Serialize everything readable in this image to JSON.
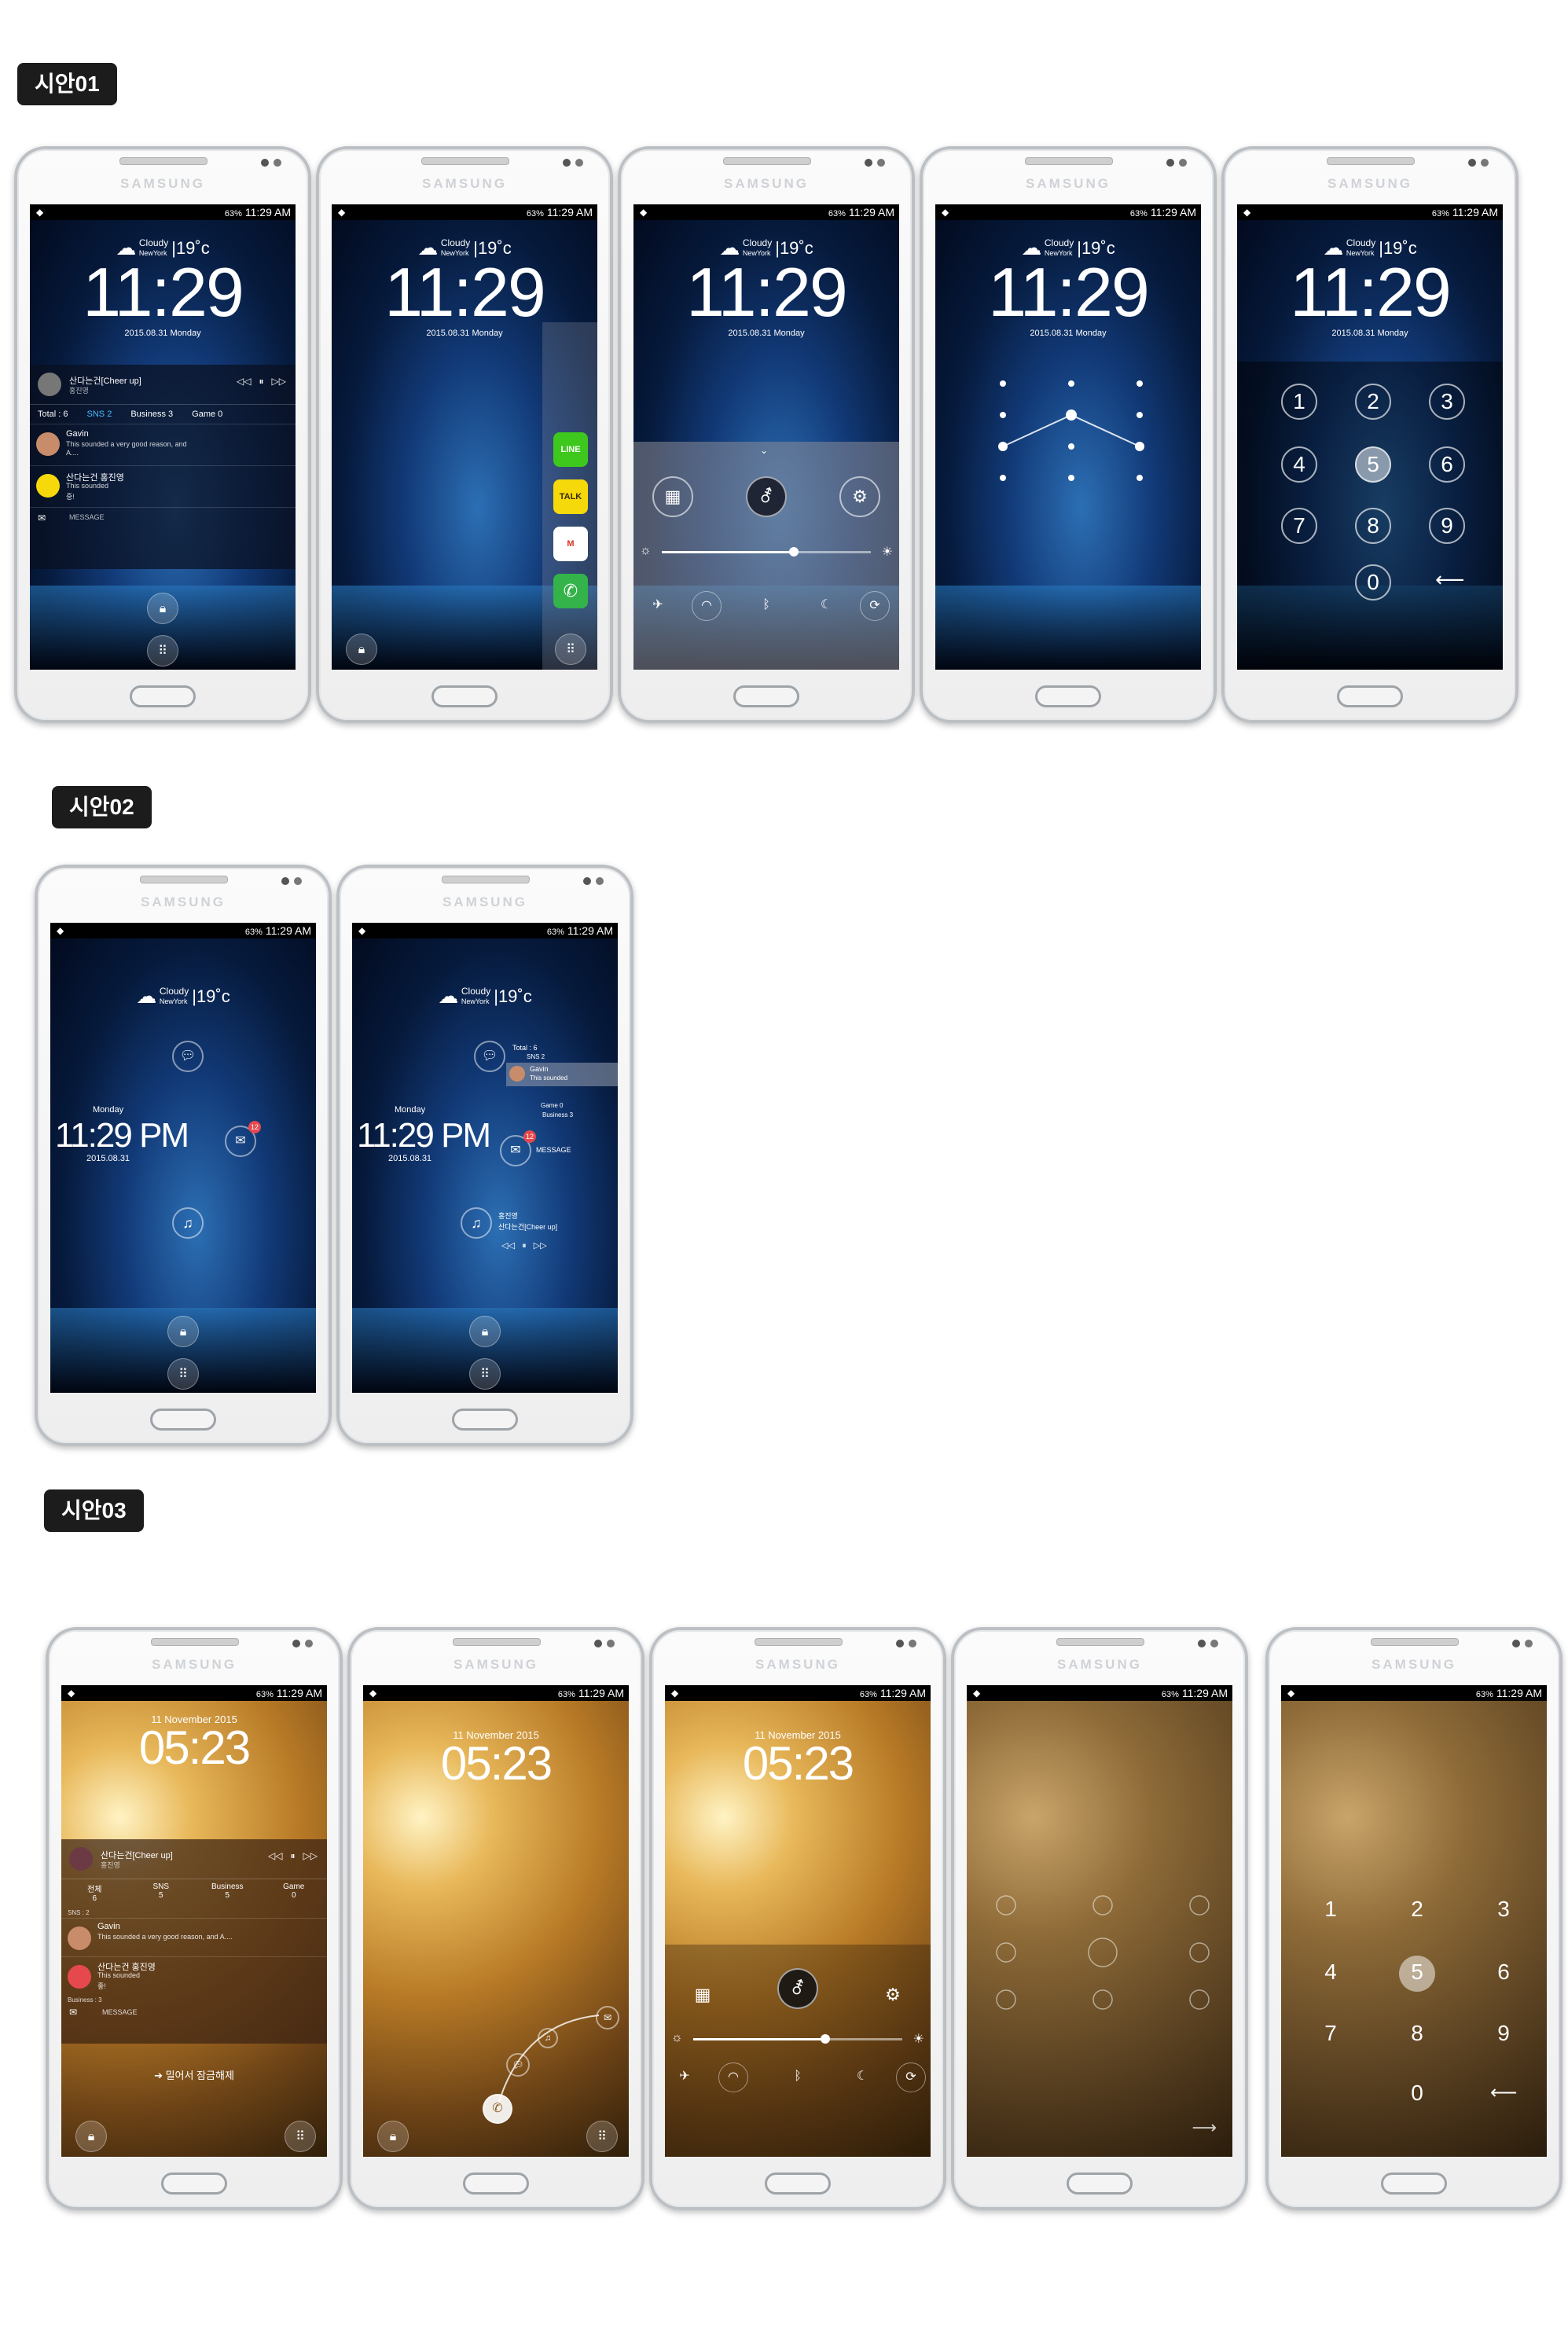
{
  "sections": {
    "s1": "시안01",
    "s2": "시안02",
    "s3": "시안03"
  },
  "device": {
    "brand": "SAMSUNG"
  },
  "status": {
    "battery": "63%",
    "time": "11:29 AM"
  },
  "night": {
    "weather": {
      "cond": "Cloudy",
      "city": "NewYork",
      "temp": "|19˚c"
    },
    "clock": "11:29",
    "date": "2015.08.31 Monday",
    "music": {
      "title": "산다는건[Cheer up]",
      "artist": "홍진영"
    },
    "tabs": {
      "total": "Total : 6",
      "sns": "SNS 2",
      "business": "Business 3",
      "game": "Game 0"
    },
    "notif1": {
      "name": "Gavin",
      "text": "This sounded a very good reason, and A...."
    },
    "notif2": {
      "name": "산다는건 홍진영",
      "text": "This sounded",
      "sub": "중!"
    },
    "message": "MESSAGE",
    "apps": {
      "line": "LINE",
      "talk": "TALK",
      "mail": "M",
      "phone": "✆"
    },
    "keypad": [
      "1",
      "2",
      "3",
      "4",
      "5",
      "6",
      "7",
      "8",
      "9",
      "0"
    ]
  },
  "v2": {
    "weekday": "Monday",
    "clock": "11:29 PM",
    "date": "2015.08.31",
    "total": "Total : 6",
    "sns": "SNS 2",
    "gavin": "Gavin",
    "sounded": "This sounded",
    "game": "Game 0",
    "business": "Business 3",
    "message": "MESSAGE",
    "song_artist": "홍진영",
    "song_title": "산다는건[Cheer up]",
    "badge": "12"
  },
  "v3": {
    "date": "11 November 2015",
    "clock": "05:23",
    "music": {
      "title": "산다는건[Cheer up]",
      "artist": "홍진영"
    },
    "tabs": [
      {
        "label": "전체",
        "count": "6"
      },
      {
        "label": "SNS",
        "count": "5"
      },
      {
        "label": "Business",
        "count": "5"
      },
      {
        "label": "Game",
        "count": "0"
      }
    ],
    "sns_header": "SNS : 2",
    "notif1": {
      "name": "Gavin",
      "text": "This sounded a very good reason, and A...."
    },
    "notif2": {
      "name": "산다는건 홍진영",
      "text": "This sounded",
      "sub": "좋!"
    },
    "business_header": "Business : 3",
    "message": "MESSAGE",
    "unlock_hint": "밀어서 잠금해제",
    "keypad": [
      "1",
      "2",
      "3",
      "4",
      "5",
      "6",
      "7",
      "8",
      "9",
      "0"
    ]
  },
  "colors": {
    "accent_badge": "#e5484d",
    "line_green": "#3ec81e",
    "talk_yellow": "#f5d90a",
    "phone_green": "#33b34a"
  }
}
